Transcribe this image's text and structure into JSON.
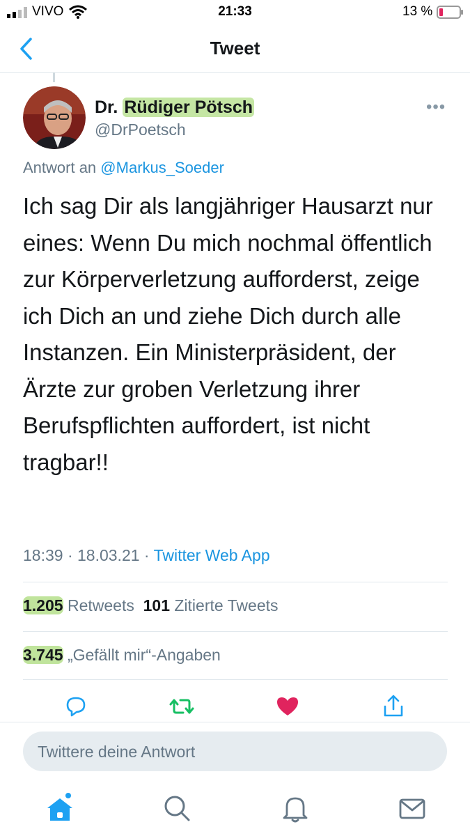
{
  "status_bar": {
    "carrier": "VIVO",
    "time": "21:33",
    "battery": "13 %"
  },
  "nav": {
    "title": "Tweet"
  },
  "tweet": {
    "author_name_prefix": "Dr.",
    "author_name_main": "Rüdiger Pötsch",
    "handle": "@DrPoetsch",
    "reply_label": "Antwort an",
    "reply_mention": "@Markus_Soeder",
    "text": "Ich sag Dir als langjähriger Hausarzt nur eines: Wenn Du mich nochmal öffentlich zur Körperverletzung aufforderst, zeige ich Dich an und ziehe Dich durch alle Instanzen. Ein Ministerpräsident, der Ärzte zur groben Verletzung ihrer Berufspflichten auffordert, ist nicht tragbar!!",
    "time": "18:39 · 18.03.21 ·",
    "source": "Twitter Web App",
    "retweets_count": "1.205",
    "retweets_label": "Retweets",
    "quotes_count": "101",
    "quotes_label": "Zitierte Tweets",
    "likes_count": "3.745",
    "likes_label": "„Gefällt mir“-Angaben"
  },
  "reply": {
    "placeholder": "Twittere deine Antwort"
  },
  "colors": {
    "accent": "#1da1f2",
    "retweet": "#17bf63",
    "like": "#e0245e",
    "highlight": "#96d25a"
  }
}
